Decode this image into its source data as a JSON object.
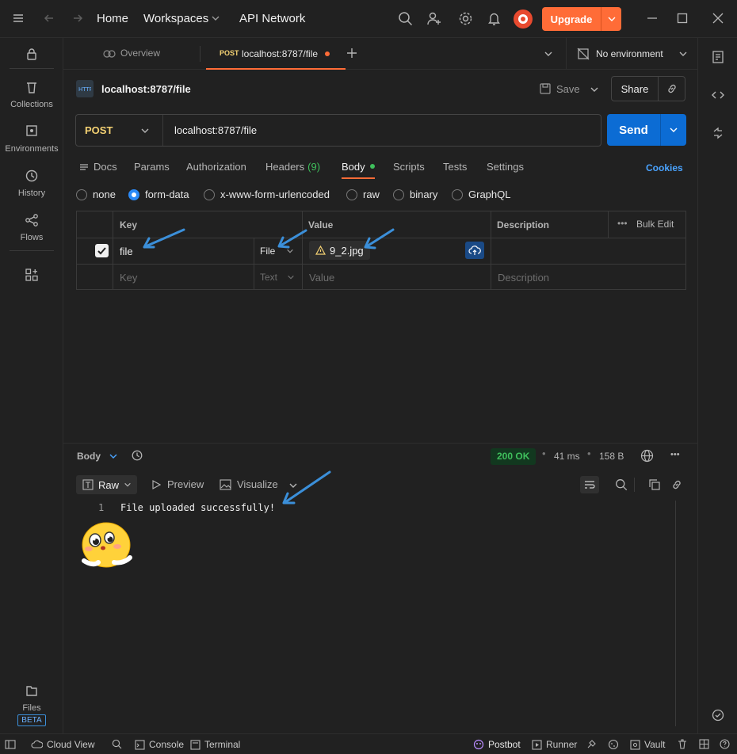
{
  "topbar": {
    "nav": [
      "Home",
      "Workspaces",
      "API Network"
    ],
    "upgrade_label": "Upgrade"
  },
  "sidebar": {
    "items": [
      {
        "label": "Collections",
        "icon": "trash-can-icon"
      },
      {
        "label": "Environments",
        "icon": "environment-icon"
      },
      {
        "label": "History",
        "icon": "history-icon"
      },
      {
        "label": "Flows",
        "icon": "flows-icon"
      }
    ],
    "files_label": "Files",
    "beta_label": "BETA"
  },
  "tabs": {
    "overview_label": "Overview",
    "active_method": "POST",
    "active_label": "localhost:8787/file",
    "environment_label": "No environment"
  },
  "request": {
    "title": "localhost:8787/file",
    "save_label": "Save",
    "share_label": "Share",
    "method": "POST",
    "url": "localhost:8787/file",
    "send_label": "Send"
  },
  "request_tabs": {
    "docs": "Docs",
    "params": "Params",
    "authorization": "Authorization",
    "headers": "Headers",
    "headers_count": "(9)",
    "body": "Body",
    "scripts": "Scripts",
    "tests": "Tests",
    "settings": "Settings",
    "cookies": "Cookies"
  },
  "body_modes": [
    "none",
    "form-data",
    "x-www-form-urlencoded",
    "raw",
    "binary",
    "GraphQL"
  ],
  "body_mode_selected": "form-data",
  "form_table": {
    "headers": {
      "key": "Key",
      "value": "Value",
      "description": "Description",
      "bulk_edit": "Bulk Edit"
    },
    "row": {
      "key": "file",
      "type": "File",
      "value": "9_2.jpg"
    },
    "placeholder": {
      "key": "Key",
      "type": "Text",
      "value": "Value",
      "description": "Description"
    }
  },
  "response": {
    "body_label": "Body",
    "status": "200 OK",
    "time": "41 ms",
    "size": "158 B",
    "raw_label": "Raw",
    "preview_label": "Preview",
    "visualize_label": "Visualize",
    "line_number": "1",
    "line_text": "File uploaded successfully!"
  },
  "statusbar": {
    "cloud_view": "Cloud View",
    "console": "Console",
    "terminal": "Terminal",
    "postbot": "Postbot",
    "runner": "Runner",
    "vault": "Vault"
  },
  "colors": {
    "accent": "#ff6c37",
    "send": "#0c6cd4",
    "status_ok": "#0f8a3a",
    "link": "#4aa3ff",
    "method_post": "#f5d273",
    "annotation_arrow": "#3b8fd9"
  }
}
